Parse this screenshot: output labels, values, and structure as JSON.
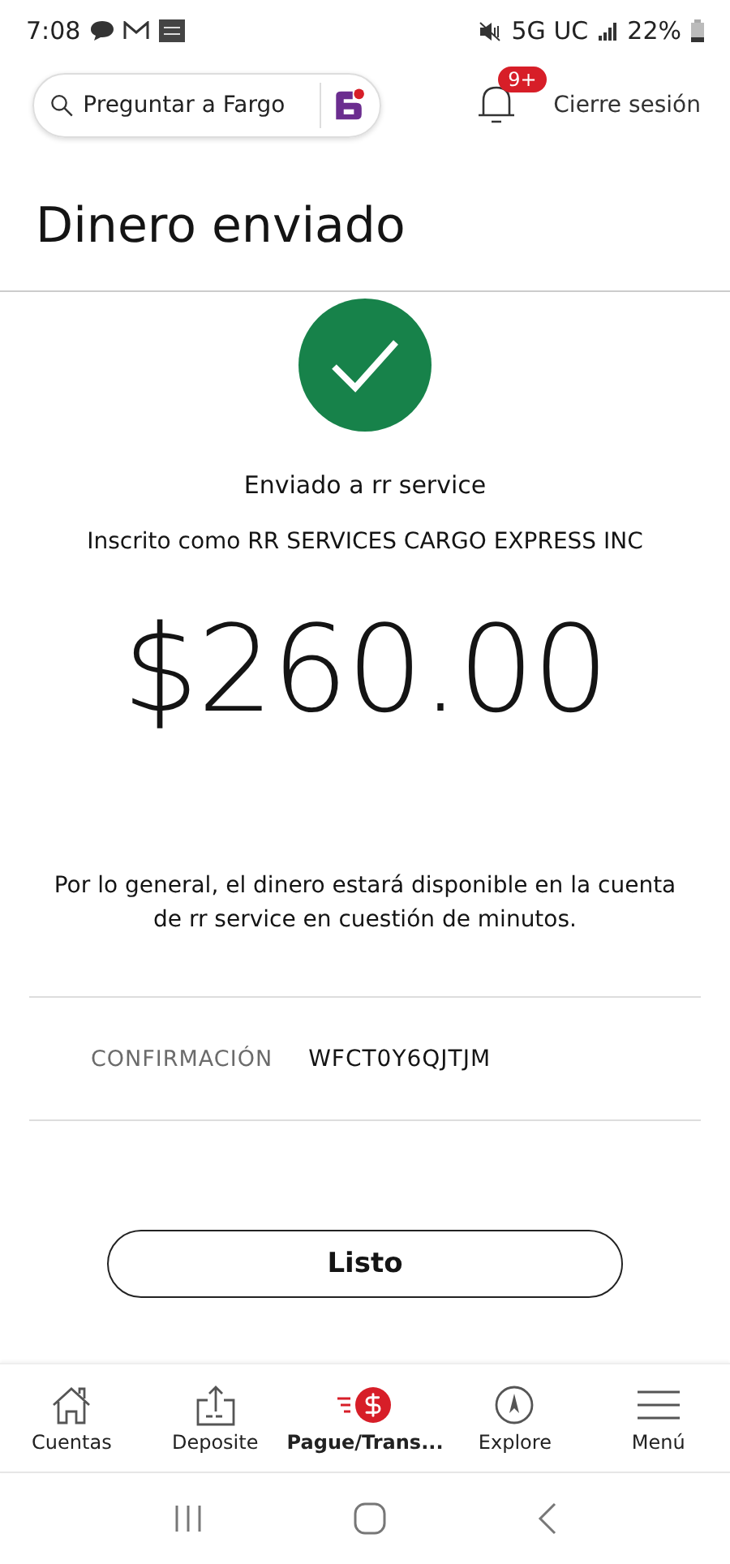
{
  "status_bar": {
    "time": "7:08",
    "network": "5G UC",
    "battery": "22%"
  },
  "header": {
    "search": {
      "placeholder": "Preguntar a Fargo"
    },
    "notifications": {
      "badge": "9+"
    },
    "logout": "Cierre sesión"
  },
  "title": "Dinero enviado",
  "confirmation": {
    "sent_to": "Enviado a rr service",
    "enrolled_as": "Inscrito como RR SERVICES CARGO EXPRESS INC",
    "amount": "$260.00",
    "note": "Por lo general, el dinero estará disponible en la cuenta de rr service en cuestión de minutos.",
    "code_label": "CONFIRMACIÓN",
    "code": "WFCT0Y6QJTJM"
  },
  "done_button": "Listo",
  "tab_bar": [
    {
      "kind": "home",
      "label": "Cuentas",
      "selected": false
    },
    {
      "kind": "deposit",
      "label": "Deposite",
      "selected": false
    },
    {
      "kind": "pay",
      "label": "Pague/Trans...",
      "selected": true
    },
    {
      "kind": "explore",
      "label": "Explore",
      "selected": false
    },
    {
      "kind": "menu",
      "label": "Menú",
      "selected": false
    }
  ]
}
